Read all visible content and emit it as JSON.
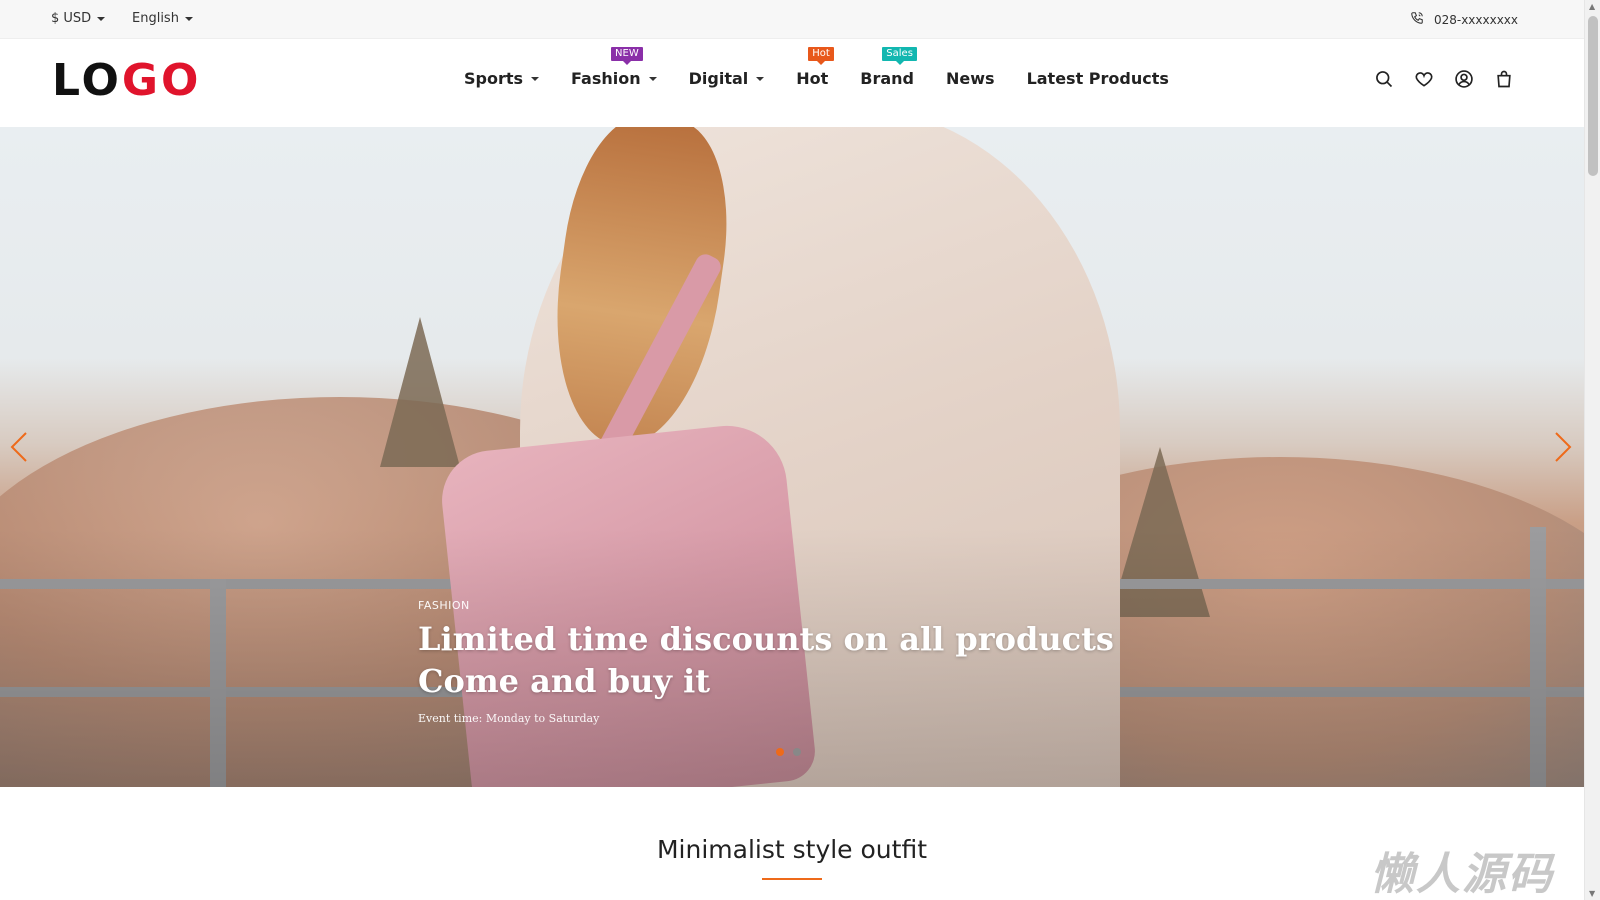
{
  "topbar": {
    "currency": "$ USD",
    "language": "English",
    "phone": "028-xxxxxxxx"
  },
  "header": {
    "logo_part1": "LO",
    "logo_part2": "GO",
    "nav": [
      {
        "label": "Sports",
        "dropdown": true
      },
      {
        "label": "Fashion",
        "dropdown": true,
        "badge": "NEW",
        "badge_color": "#8a2fa8"
      },
      {
        "label": "Digital",
        "dropdown": true
      },
      {
        "label": "Hot",
        "dropdown": false,
        "badge": "Hot",
        "badge_color": "#e8581b"
      },
      {
        "label": "Brand",
        "dropdown": false,
        "badge": "Sales",
        "badge_color": "#12b7b0"
      },
      {
        "label": "News",
        "dropdown": false
      },
      {
        "label": "Latest Products",
        "dropdown": false
      }
    ],
    "icons": [
      "search-icon",
      "heart-icon",
      "user-icon",
      "bag-icon"
    ]
  },
  "hero": {
    "tag": "FASHION",
    "title_line1": "Limited time discounts on all products",
    "title_line2": "Come and buy it",
    "subtitle": "Event time: Monday to Saturday",
    "slides": 2,
    "active_slide": 1,
    "accent": "#ee6a1a"
  },
  "section": {
    "title": "Minimalist style outfit"
  },
  "watermark": "懒人源码"
}
